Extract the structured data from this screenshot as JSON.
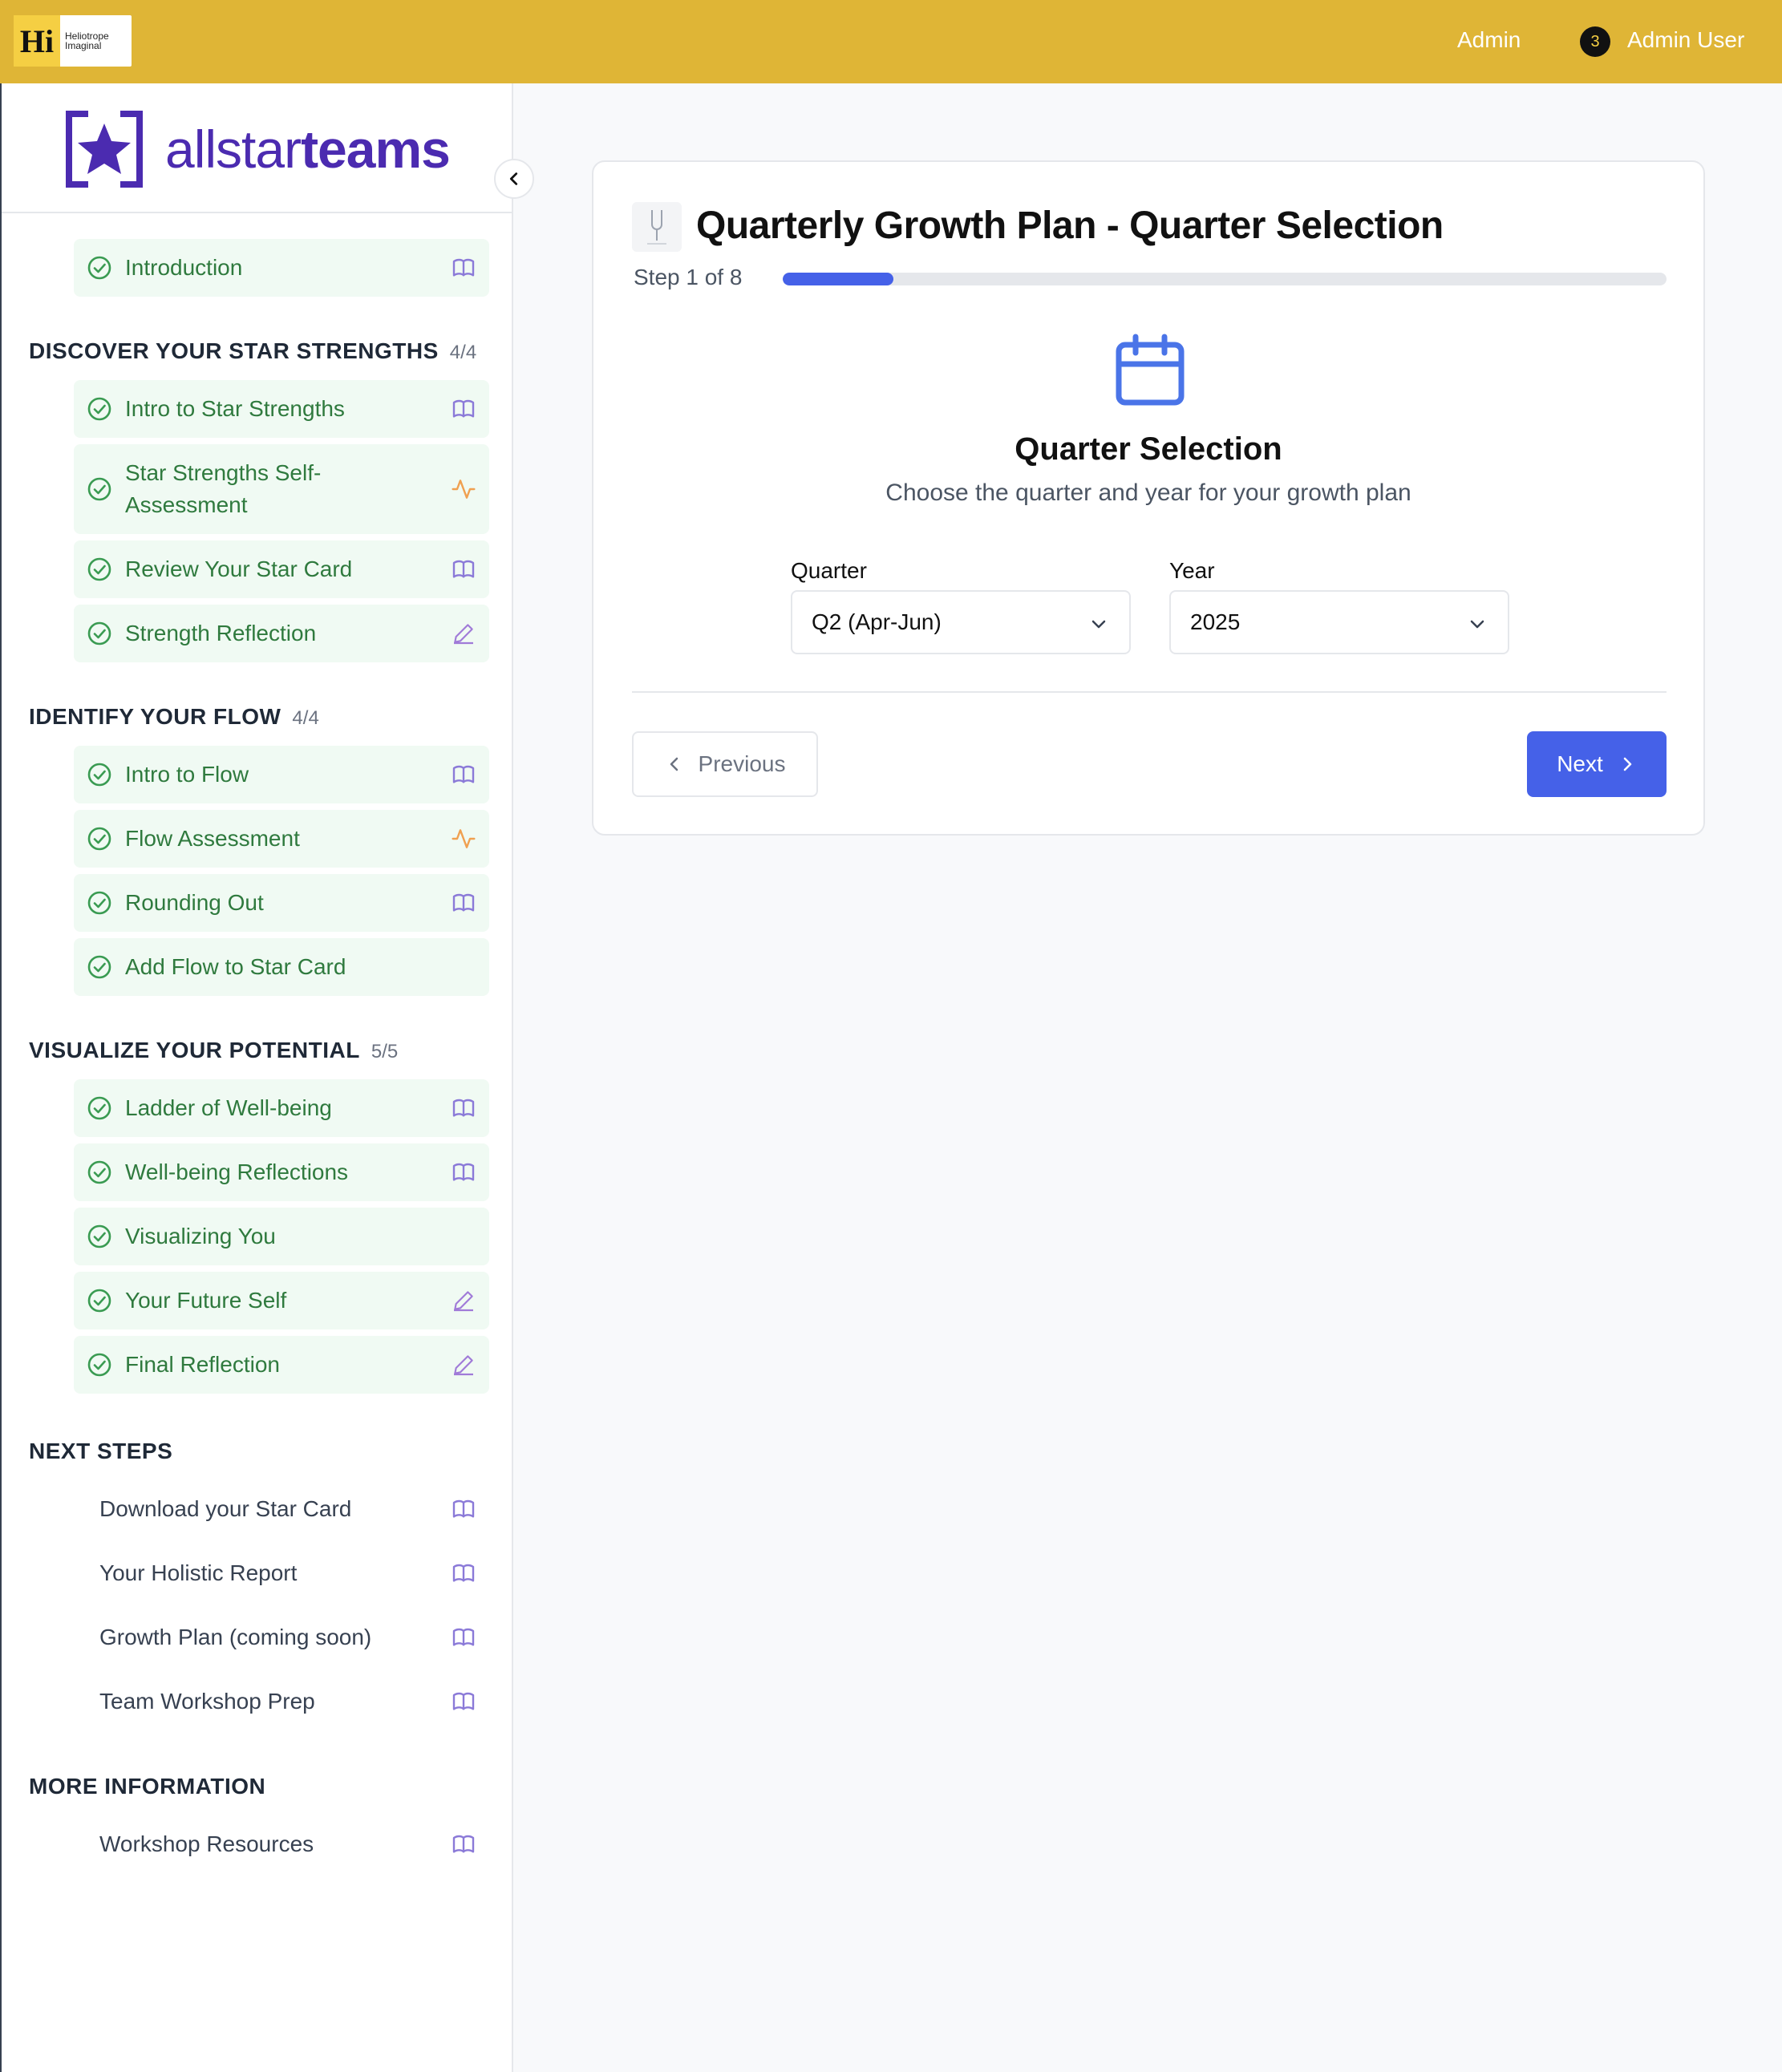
{
  "topbar": {
    "logo_letters": "Hi",
    "logo_line1": "Heliotrope",
    "logo_line2": "Imaginal",
    "admin_link": "Admin",
    "notification_count": "3",
    "user_name": "Admin User",
    "bg_color": "#dfb536"
  },
  "brand": {
    "name_light": "allstar",
    "name_bold": "teams",
    "color": "#4b2bb0"
  },
  "sidebar": {
    "intro": {
      "label": "Introduction",
      "icon": "book-icon"
    },
    "sections": [
      {
        "title": "DISCOVER YOUR STAR STRENGTHS",
        "count": "4/4",
        "items": [
          {
            "label": "Intro to Star Strengths",
            "icon": "book-icon"
          },
          {
            "label": "Star Strengths Self-Assessment",
            "icon": "activity-icon"
          },
          {
            "label": "Review Your Star Card",
            "icon": "book-icon"
          },
          {
            "label": "Strength Reflection",
            "icon": "pencil-icon"
          }
        ]
      },
      {
        "title": "IDENTIFY YOUR FLOW",
        "count": "4/4",
        "items": [
          {
            "label": "Intro to Flow",
            "icon": "book-icon"
          },
          {
            "label": "Flow Assessment",
            "icon": "activity-icon"
          },
          {
            "label": "Rounding Out",
            "icon": "book-icon"
          },
          {
            "label": "Add Flow to Star Card",
            "icon": ""
          }
        ]
      },
      {
        "title": "VISUALIZE YOUR POTENTIAL",
        "count": "5/5",
        "items": [
          {
            "label": "Ladder of Well-being",
            "icon": "book-icon"
          },
          {
            "label": "Well-being Reflections",
            "icon": "book-icon"
          },
          {
            "label": "Visualizing You",
            "icon": ""
          },
          {
            "label": "Your Future Self",
            "icon": "pencil-icon"
          },
          {
            "label": "Final Reflection",
            "icon": "pencil-icon"
          }
        ]
      },
      {
        "title": "NEXT STEPS",
        "items": [
          {
            "label": "Download your Star Card",
            "icon": "book-icon"
          },
          {
            "label": "Your Holistic Report",
            "icon": "book-icon"
          },
          {
            "label": "Growth Plan (coming soon)",
            "icon": "book-icon"
          },
          {
            "label": "Team Workshop Prep",
            "icon": "book-icon"
          }
        ]
      },
      {
        "title": "MORE INFORMATION",
        "items": [
          {
            "label": "Workshop Resources",
            "icon": "book-icon"
          }
        ]
      }
    ]
  },
  "main": {
    "title": "Quarterly Growth Plan - Quarter Selection",
    "step_text": "Step 1 of 8",
    "progress_fraction": 0.125,
    "section_title": "Quarter Selection",
    "section_subtitle": "Choose the quarter and year for your growth plan",
    "quarter_label": "Quarter",
    "quarter_value": "Q2 (Apr-Jun)",
    "year_label": "Year",
    "year_value": "2025",
    "prev_label": "Previous",
    "next_label": "Next",
    "accent_color": "#4561e8"
  }
}
